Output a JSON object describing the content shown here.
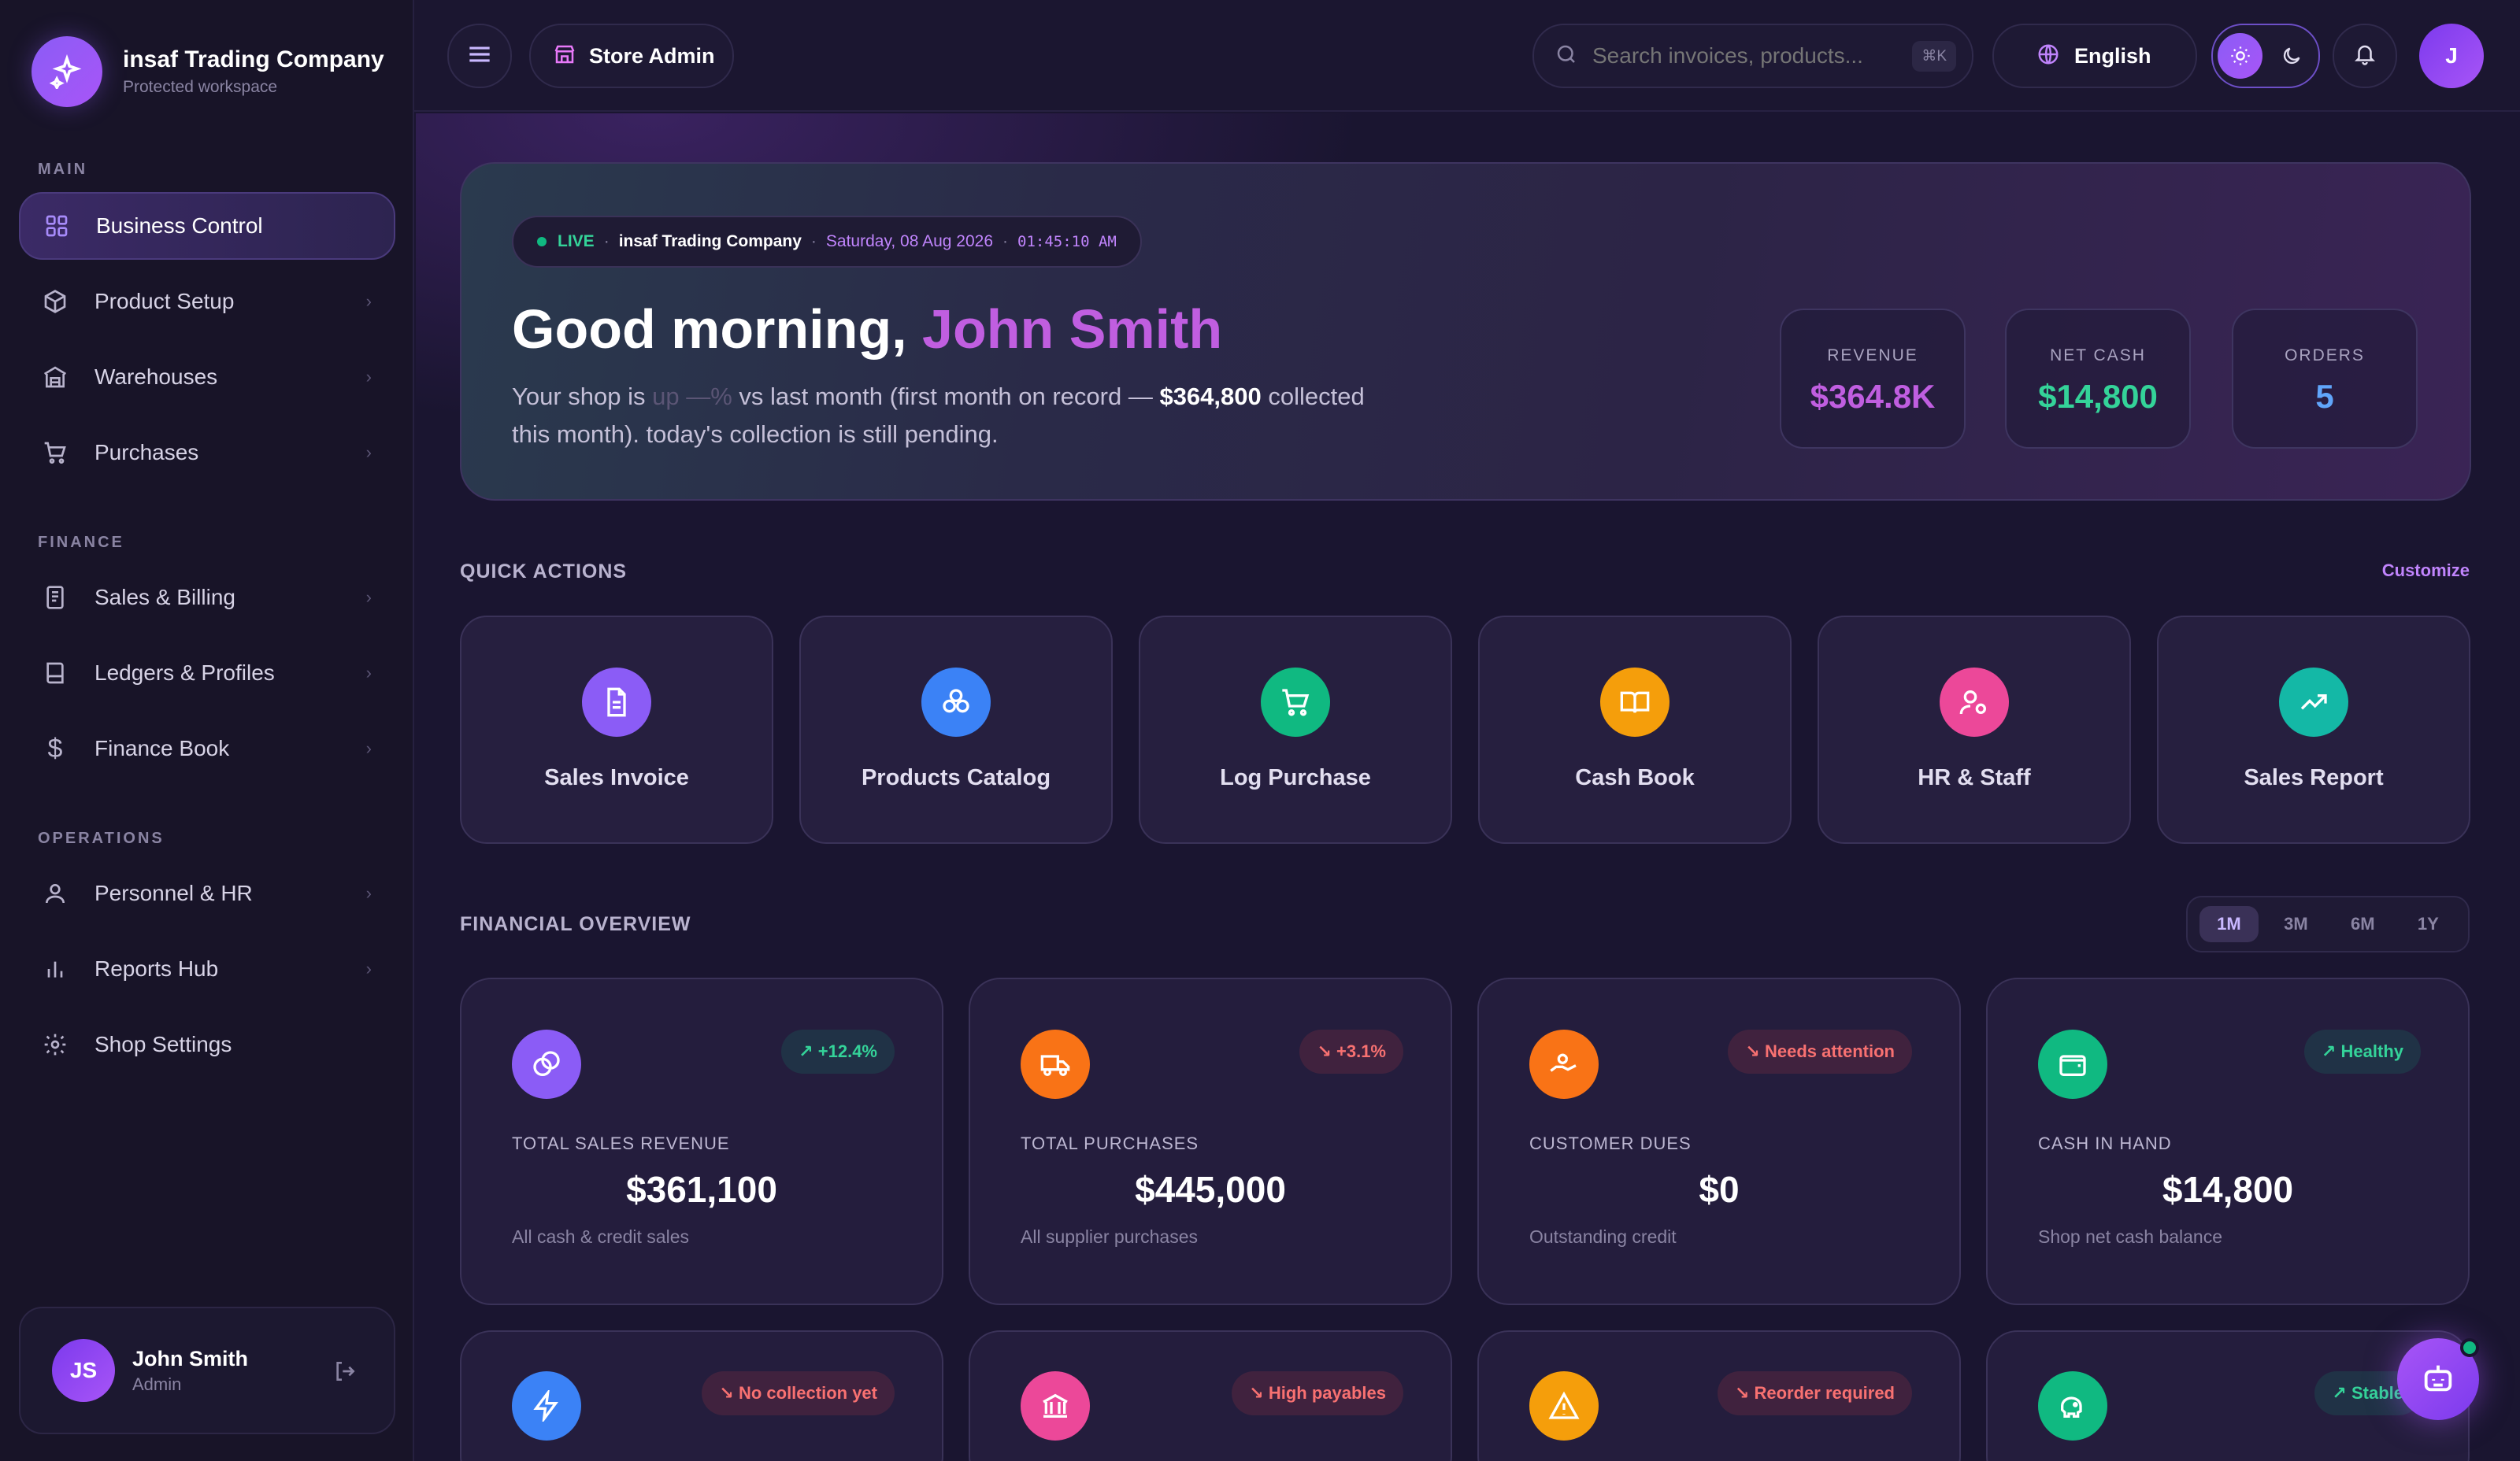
{
  "brand": {
    "name": "insaf Trading Company",
    "subtitle": "Protected workspace"
  },
  "sidebar": {
    "sections": [
      "MAIN",
      "FINANCE",
      "OPERATIONS"
    ],
    "items": [
      {
        "label": "Business Control",
        "icon": "grid-icon",
        "active": true
      },
      {
        "label": "Product Setup",
        "icon": "box-icon"
      },
      {
        "label": "Warehouses",
        "icon": "warehouse-icon"
      },
      {
        "label": "Purchases",
        "icon": "cart-icon"
      },
      {
        "label": "Sales & Billing",
        "icon": "receipt-icon"
      },
      {
        "label": "Ledgers & Profiles",
        "icon": "book-icon"
      },
      {
        "label": "Finance Book",
        "icon": "dollar-icon"
      },
      {
        "label": "Personnel & HR",
        "icon": "user-icon"
      },
      {
        "label": "Reports Hub",
        "icon": "bar-chart-icon"
      },
      {
        "label": "Shop Settings",
        "icon": "gear-icon"
      }
    ]
  },
  "user": {
    "name": "John Smith",
    "role": "Admin",
    "initials": "JS"
  },
  "topbar": {
    "store_label": "Store Admin",
    "search_placeholder": "Search invoices, products...",
    "shortcut": "⌘K",
    "language": "English",
    "avatar_initial": "J"
  },
  "hero": {
    "live": "LIVE",
    "company": "insaf Trading Company",
    "date": "Saturday, 08 Aug 2026",
    "time": "01:45:10 AM",
    "greeting": "Good morning,",
    "name": "John Smith",
    "desc_a": "Your shop is ",
    "desc_trend": "up —%",
    "desc_b": " vs last month (first month on record — ",
    "desc_amount": "$364,800",
    "desc_c": " collected this month). today's collection is still pending.",
    "stats": [
      {
        "label": "REVENUE",
        "value": "$364.8K",
        "color": "#c05ee0"
      },
      {
        "label": "NET CASH",
        "value": "$14,800",
        "color": "#34d399"
      },
      {
        "label": "ORDERS",
        "value": "5",
        "color": "#60a5fa"
      }
    ]
  },
  "quick_actions": {
    "title": "QUICK ACTIONS",
    "customize": "Customize",
    "items": [
      {
        "label": "Sales Invoice",
        "icon": "document-icon",
        "color": "#8b5cf6"
      },
      {
        "label": "Products Catalog",
        "icon": "boxes-icon",
        "color": "#3b82f6"
      },
      {
        "label": "Log Purchase",
        "icon": "cart-icon",
        "color": "#10b981"
      },
      {
        "label": "Cash Book",
        "icon": "book-open-icon",
        "color": "#f59e0b"
      },
      {
        "label": "HR & Staff",
        "icon": "user-gear-icon",
        "color": "#ec4899"
      },
      {
        "label": "Sales Report",
        "icon": "trend-up-icon",
        "color": "#14b8a6"
      }
    ]
  },
  "financial": {
    "title": "FINANCIAL OVERVIEW",
    "ranges": [
      "1M",
      "3M",
      "6M",
      "1Y"
    ],
    "active_range": "1M",
    "cards": [
      {
        "title": "TOTAL SALES REVENUE",
        "amount": "$361,100",
        "sub": "All cash & credit sales",
        "badge": "+12.4%",
        "badge_type": "green",
        "icon": "coins-icon",
        "color": "#8b5cf6"
      },
      {
        "title": "TOTAL PURCHASES",
        "amount": "$445,000",
        "sub": "All supplier purchases",
        "badge": "+3.1%",
        "badge_type": "red",
        "icon": "truck-icon",
        "color": "#f97316"
      },
      {
        "title": "CUSTOMER DUES",
        "amount": "$0",
        "sub": "Outstanding credit",
        "badge": "Needs attention",
        "badge_type": "red",
        "icon": "hand-coins-icon",
        "color": "#f97316"
      },
      {
        "title": "CASH IN HAND",
        "amount": "$14,800",
        "sub": "Shop net cash balance",
        "badge": "Healthy",
        "badge_type": "green",
        "icon": "wallet-icon",
        "color": "#10b981"
      }
    ],
    "cards2": [
      {
        "badge": "No collection yet",
        "badge_type": "red",
        "icon": "lightning-icon",
        "color": "#3b82f6"
      },
      {
        "badge": "High payables",
        "badge_type": "red",
        "icon": "bank-icon",
        "color": "#ec4899"
      },
      {
        "badge": "Reorder required",
        "badge_type": "red",
        "icon": "warning-icon",
        "color": "#f59e0b"
      },
      {
        "badge": "Stable",
        "badge_type": "green",
        "icon": "piggy-bank-icon",
        "color": "#10b981"
      }
    ]
  }
}
